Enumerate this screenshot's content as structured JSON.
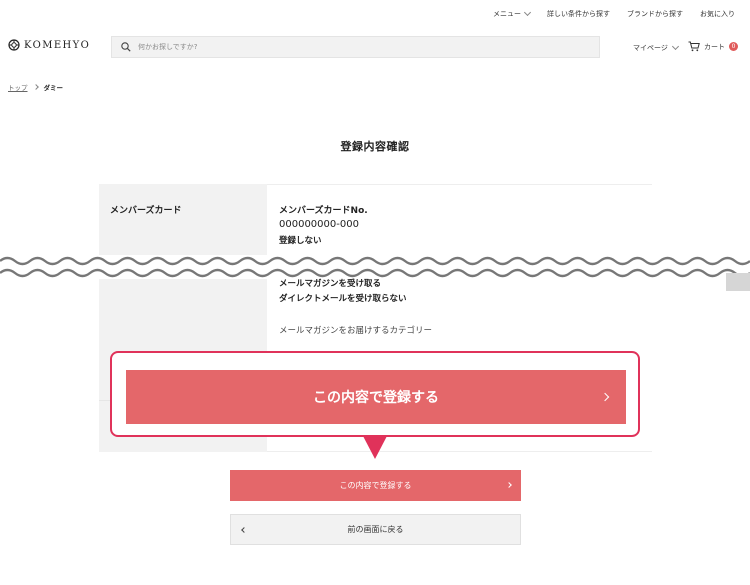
{
  "util_nav": {
    "menu": "メニュー",
    "detail_search": "詳しい条件から探す",
    "brand_search": "ブランドから探す",
    "favorites": "お気に入り"
  },
  "header": {
    "logo": "KOMEHYO",
    "search_placeholder": "何かお探しですか?",
    "mypage": "マイページ",
    "cart": "カート",
    "cart_count": "0"
  },
  "breadcrumb": {
    "home": "トップ",
    "current": "ダミー"
  },
  "page_title": "登録内容確認",
  "registration": {
    "label": "メンバーズカード",
    "card_no_label": "メンバーズカードNo.",
    "card_no": "000000000-000",
    "register_status": "登録しない",
    "magazine": "メールマガジンを受け取る",
    "direct_mail": "ダイレクトメールを受け取らない",
    "category_label": "メールマガジンをお届けするカテゴリー"
  },
  "callout": {
    "button_label": "この内容で登録する"
  },
  "actions": {
    "submit_label": "この内容で登録する",
    "back_label": "前の画面に戻る"
  },
  "colors": {
    "accent": "#e4676a",
    "callout_border": "#e0325a",
    "badge": "#e05a5a",
    "label_bg": "#f2f2f2"
  }
}
